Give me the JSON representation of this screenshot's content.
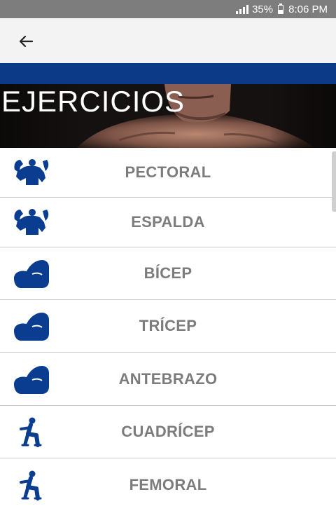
{
  "status_bar": {
    "battery": "35%",
    "time": "8:06 PM"
  },
  "app_bar": {
    "back_icon": "arrow-left-icon"
  },
  "hero": {
    "title": "EJERCICIOS"
  },
  "exercises": [
    {
      "label": "PECTORAL",
      "icon": "bodybuilder-icon"
    },
    {
      "label": "ESPALDA",
      "icon": "bodybuilder-icon"
    },
    {
      "label": "BÍCEP",
      "icon": "flexed-arm-icon"
    },
    {
      "label": "TRÍCEP",
      "icon": "flexed-arm-icon"
    },
    {
      "label": "ANTEBRAZO",
      "icon": "flexed-arm-icon"
    },
    {
      "label": "CUADRÍCEP",
      "icon": "squat-figure-icon"
    },
    {
      "label": "FEMORAL",
      "icon": "squat-figure-icon"
    }
  ],
  "colors": {
    "status_bar": "#7d7d7d",
    "app_bar": "#f3f3f3",
    "accent_blue": "#0c3a86",
    "icon_blue": "#0a3d8f",
    "label_gray": "#7c7c7c"
  }
}
